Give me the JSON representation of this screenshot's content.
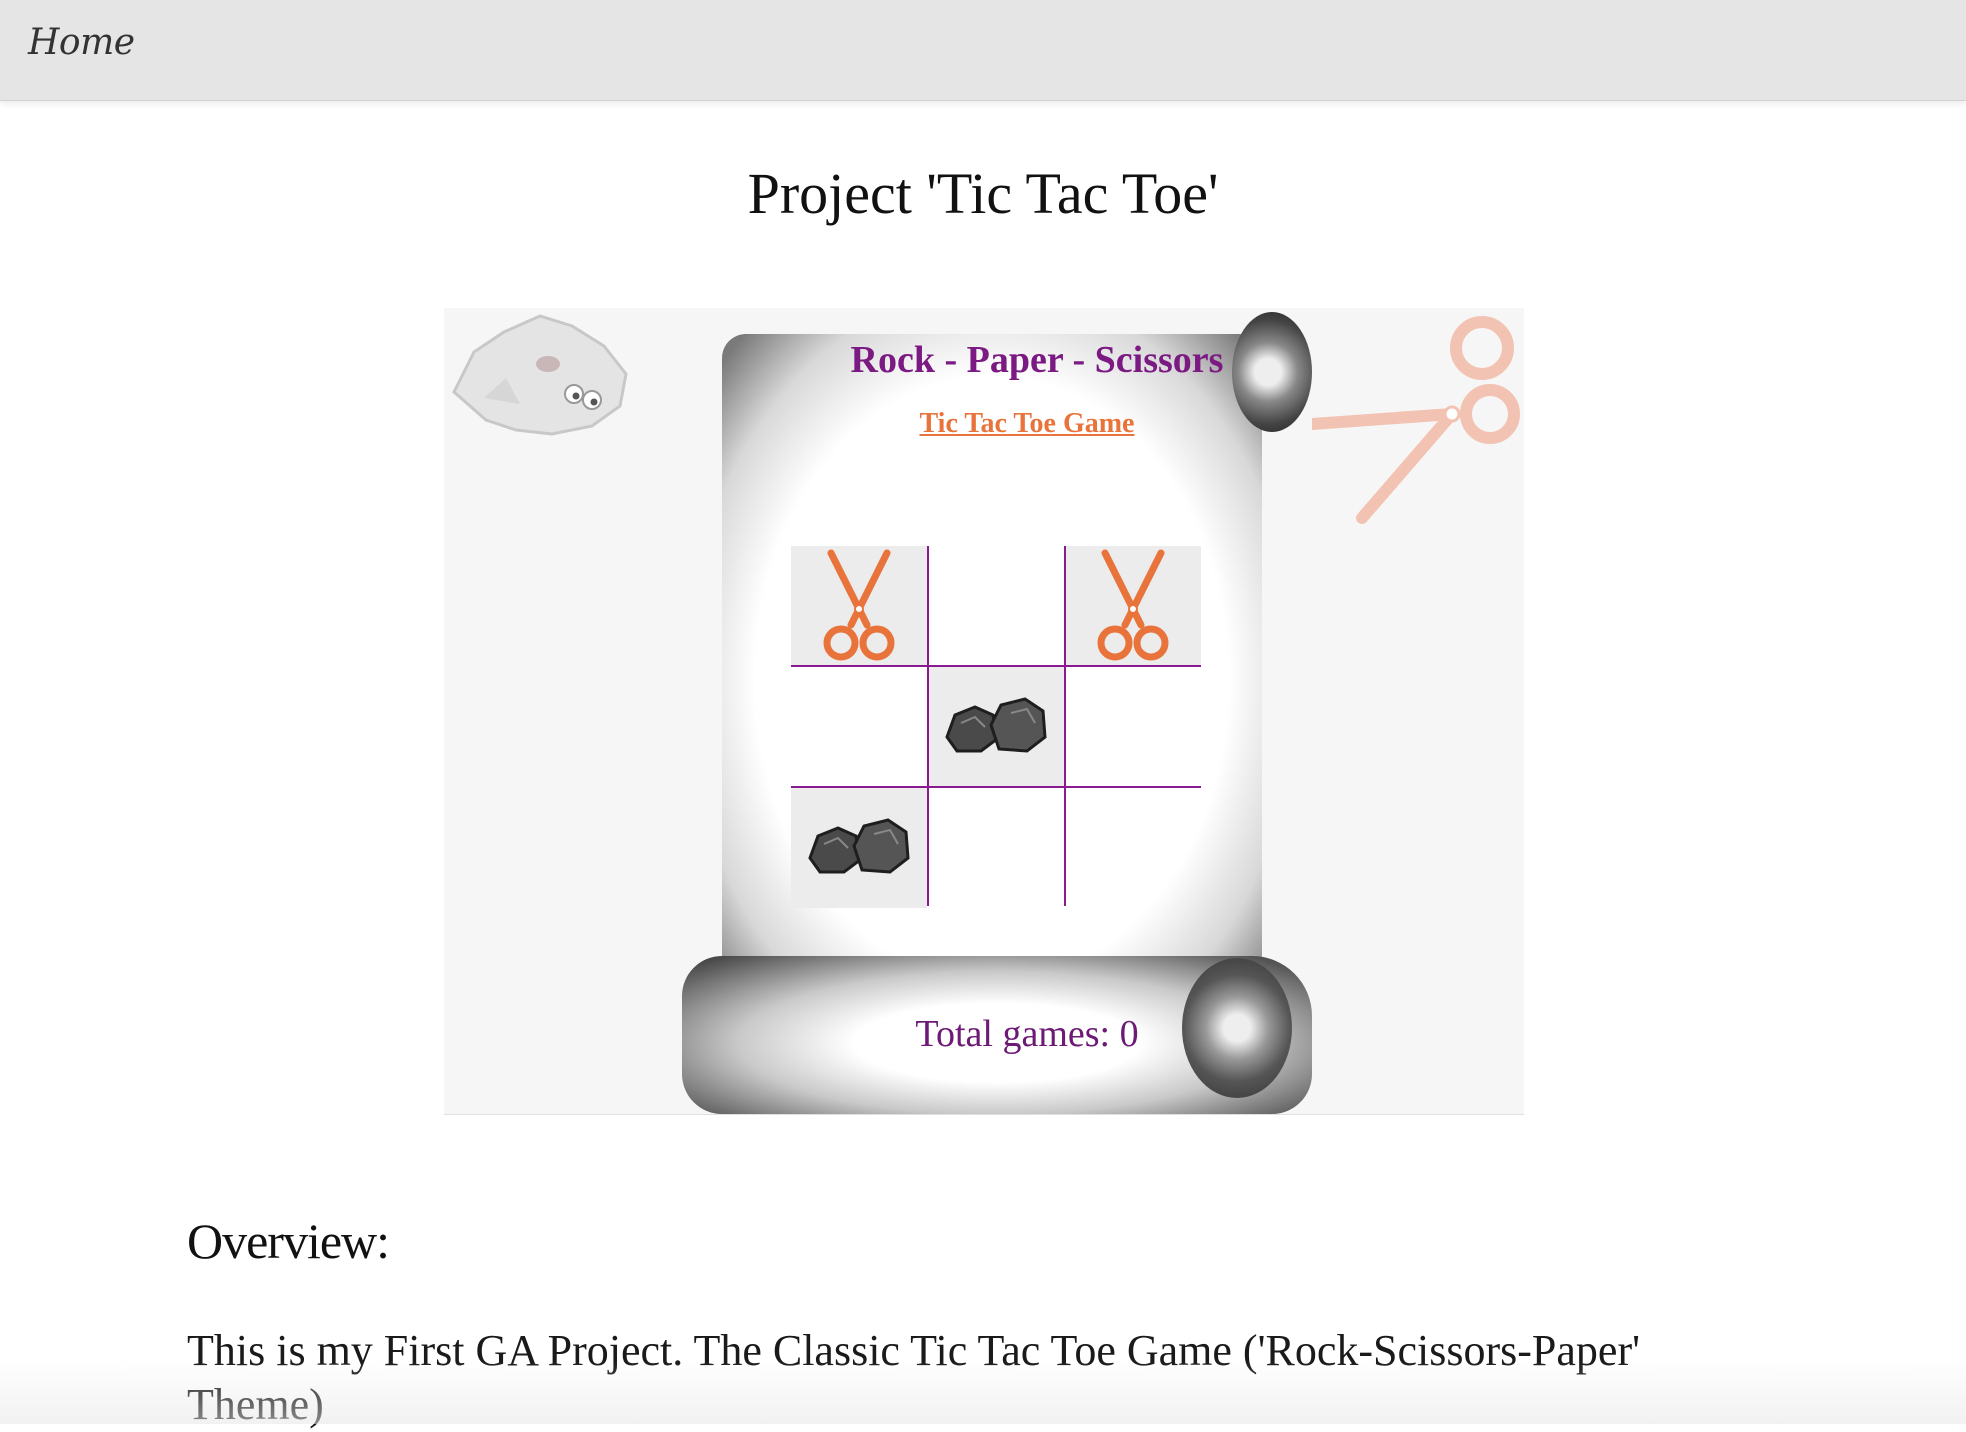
{
  "nav": {
    "home_label": "Home"
  },
  "page": {
    "title": "Project 'Tic Tac Toe'"
  },
  "preview": {
    "game_title": "Rock - Paper - Scissors",
    "game_subtitle": "Tic Tac Toe Game",
    "total_games_label": "Total games: 0",
    "board": [
      [
        "scissors",
        "",
        "scissors"
      ],
      [
        "",
        "rock",
        ""
      ],
      [
        "rock",
        "",
        ""
      ]
    ],
    "colors": {
      "title": "#7b1a82",
      "subtitle": "#e8743b",
      "grid": "#8a1a8f",
      "scissors": "#e8743b"
    }
  },
  "overview": {
    "heading": "Overview:",
    "text": "This is my First GA Project. The Classic Tic Tac Toe Game ('Rock-Scissors-Paper' Theme)"
  }
}
